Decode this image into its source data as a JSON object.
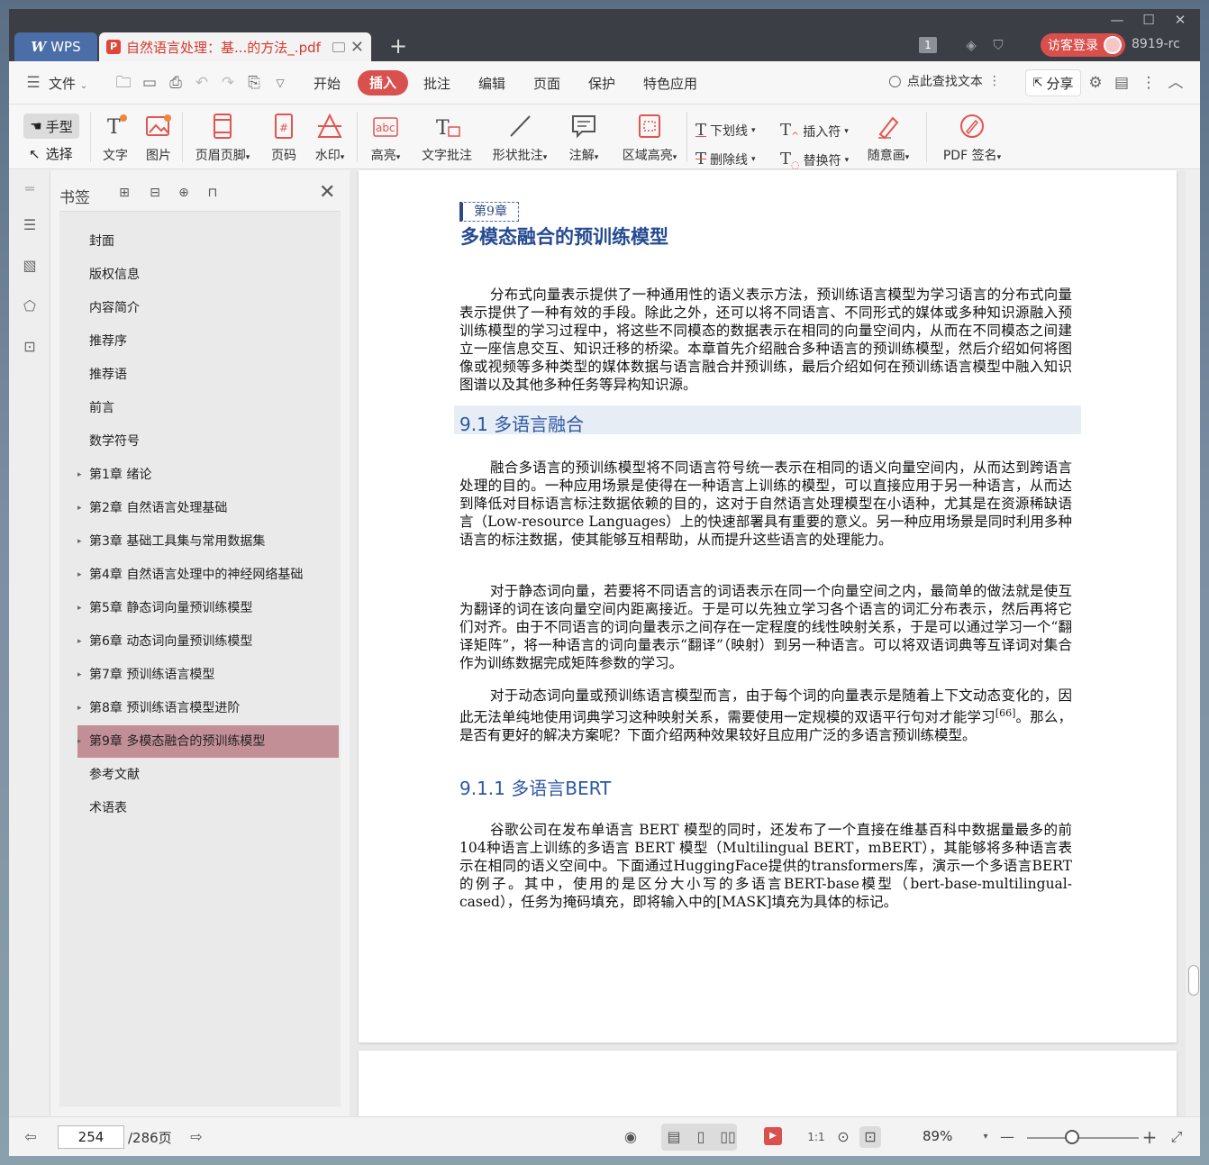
{
  "tabs": {
    "wps_label": "WPS",
    "doc_title": "自然语言处理：基...的方法_.pdf",
    "badge_count": "1",
    "login_label": "访客登录",
    "user_id": "8919-rc"
  },
  "menubar": {
    "file": "文件",
    "items": [
      "开始",
      "插入",
      "批注",
      "编辑",
      "页面",
      "保护",
      "特色应用"
    ],
    "active": "插入",
    "search_label": "点此查找文本",
    "share_label": "分享"
  },
  "ribbon": {
    "hand": "手型",
    "select": "选择",
    "text": "文字",
    "image": "图片",
    "header_footer": "页眉页脚",
    "page_number": "页码",
    "watermark": "水印",
    "highlight": "高亮",
    "text_comment": "文字批注",
    "shape_comment": "形状批注",
    "annotation": "注解",
    "area_highlight": "区域高亮",
    "underline": "下划线",
    "strikethrough": "删除线",
    "insert_mark": "插入符",
    "replace_mark": "替换符",
    "freehand": "随意画",
    "pdf_sign": "PDF 签名"
  },
  "bookmarks": {
    "title": "书签",
    "items": [
      {
        "label": "封面",
        "expandable": false
      },
      {
        "label": "版权信息",
        "expandable": false
      },
      {
        "label": "内容简介",
        "expandable": false
      },
      {
        "label": "推荐序",
        "expandable": false
      },
      {
        "label": "推荐语",
        "expandable": false
      },
      {
        "label": "前言",
        "expandable": false
      },
      {
        "label": "数学符号",
        "expandable": false
      },
      {
        "label": "第1章 绪论",
        "expandable": true
      },
      {
        "label": "第2章 自然语言处理基础",
        "expandable": true
      },
      {
        "label": "第3章 基础工具集与常用数据集",
        "expandable": true
      },
      {
        "label": "第4章 自然语言处理中的神经网络基础",
        "expandable": true
      },
      {
        "label": "第5章 静态词向量预训练模型",
        "expandable": true
      },
      {
        "label": "第6章 动态词向量预训练模型",
        "expandable": true
      },
      {
        "label": "第7章 预训练语言模型",
        "expandable": true
      },
      {
        "label": "第8章 预训练语言模型进阶",
        "expandable": true
      },
      {
        "label": "第9章 多模态融合的预训练模型",
        "expandable": true,
        "selected": true
      },
      {
        "label": "参考文献",
        "expandable": false
      },
      {
        "label": "术语表",
        "expandable": false
      }
    ]
  },
  "document": {
    "chapter_tag": "第9章",
    "chapter_title": "多模态融合的预训练模型",
    "intro": "分布式向量表示提供了一种通用性的语义表示方法，预训练语言模型为学习语言的分布式向量表示提供了一种有效的手段。除此之外，还可以将不同语言、不同形式的媒体或多种知识源融入预训练模型的学习过程中，将这些不同模态的数据表示在相同的向量空间内，从而在不同模态之间建立一座信息交互、知识迁移的桥梁。本章首先介绍融合多种语言的预训练模型，然后介绍如何将图像或视频等多种类型的媒体数据与语言融合并预训练，最后介绍如何在预训练语言模型中融入知识图谱以及其他多种任务等异构知识源。",
    "section_title": "9.1  多语言融合",
    "para1": "融合多语言的预训练模型将不同语言符号统一表示在相同的语义向量空间内，从而达到跨语言处理的目的。一种应用场景是使得在一种语言上训练的模型，可以直接应用于另一种语言，从而达到降低对目标语言标注数据依赖的目的，这对于自然语言处理模型在小语种，尤其是在资源稀缺语言（Low-resource Languages）上的快速部署具有重要的意义。另一种应用场景是同时利用多种语言的标注数据，使其能够互相帮助，从而提升这些语言的处理能力。",
    "para2": "对于静态词向量，若要将不同语言的词语表示在同一个向量空间之内，最简单的做法就是使互为翻译的词在该向量空间内距离接近。于是可以先独立学习各个语言的词汇分布表示，然后再将它们对齐。由于不同语言的词向量表示之间存在一定程度的线性映射关系，于是可以通过学习一个“翻译矩阵”，将一种语言的词向量表示“翻译”（映射）到另一种语言。可以将双语词典等互译词对集合作为训练数据完成矩阵参数的学习。",
    "para3_a": "对于动态词向量或预训练语言模型而言，由于每个词的向量表示是随着上下文动态变化的，因此无法单纯地使用词典学习这种映射关系，需要使用一定规模的双语平行句对才能学习",
    "para3_cite": "[66]",
    "para3_b": "。那么，是否有更好的解决方案呢？下面介绍两种效果较好且应用广泛的多语言预训练模型。",
    "subsection_title": "9.1.1  多语言BERT",
    "para4": "谷歌公司在发布单语言 BERT 模型的同时，还发布了一个直接在维基百科中数据量最多的前104种语言上训练的多语言 BERT 模型（Multilingual BERT，mBERT），其能够将多种语言表示在相同的语义空间中。下面通过HuggingFace提供的transformers库，演示一个多语言BERT的例子。其中，使用的是区分大小写的多语言BERT-base模型（bert-base-multilingual-cased），任务为掩码填充，即将输入中的[MASK]填充为具体的标记。"
  },
  "statusbar": {
    "current_page": "254",
    "total_pages": "/286页",
    "zoom": "89%"
  }
}
